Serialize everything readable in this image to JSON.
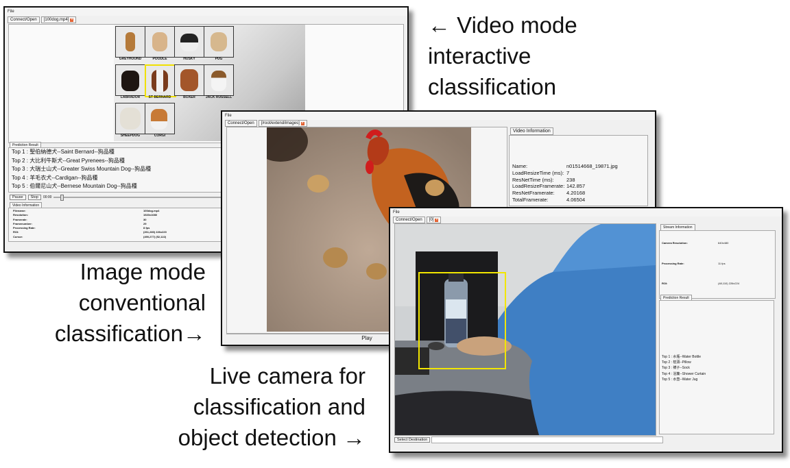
{
  "captions": {
    "video_mode": [
      "← Video mode",
      "interactive",
      "classification"
    ],
    "image_mode": [
      "Image mode",
      "conventional",
      "classification→"
    ],
    "live_camera": [
      "Live camera for",
      "classification and",
      "object detection →"
    ]
  },
  "video_window": {
    "menu": "File",
    "tabs": [
      "Connect/Open",
      "[100dog.mp4]"
    ],
    "breeds": [
      "GREYHOUND",
      "POODLE",
      "HUSKY",
      "PUG",
      "LABRADOR",
      "ST BERNARD",
      "BOXER",
      "JACK RUSSELL",
      "SHEEPDOG",
      "CORGI"
    ],
    "prediction_tab": "Prediction Result",
    "predictions": [
      "Top 1 : 聖伯納德犬--Saint Bernard--狗品種",
      "Top 2 : 大比利牛斯犬--Great Pyrenees--狗品種",
      "Top 3 : 大瑞士山犬--Greater Swiss Mountain Dog--狗品種",
      "Top 4 : 羊毛衣犬--Cardigan--狗品種",
      "Top 5 : 伯爾尼山犬--Bernese Mountain Dog--狗品種"
    ],
    "pause_label": "Pause",
    "stop_label": "Stop",
    "time": "00:00",
    "video_info_tab": "Video Information",
    "video_info": [
      {
        "k": "Filename:",
        "v": "100dog.mp4"
      },
      {
        "k": "Resolution:",
        "v": "1920x1080"
      },
      {
        "k": "Framerate:",
        "v": "30"
      },
      {
        "k": "Framenumber:",
        "v": "29"
      },
      {
        "k": "Processing Rate:",
        "v": "8 fps"
      },
      {
        "k": "ROI:",
        "v": "(261,280) 226x220"
      },
      {
        "k": "Cursor:",
        "v": "(490,277) (52,122)"
      }
    ]
  },
  "image_window": {
    "menu": "File",
    "tabs": [
      "Connect/Open",
      "[/root/extend/images]"
    ],
    "info_tab": "Video Information",
    "info": [
      {
        "k": "Name:",
        "v": "n01514668_19871.jpg"
      },
      {
        "k": "LoadResizeTime (ms):",
        "v": "7"
      },
      {
        "k": "ResNetTime (ms):",
        "v": "238"
      },
      {
        "k": "LoadResizeFramerate:",
        "v": "142.857"
      },
      {
        "k": "ResNetFramerate:",
        "v": "4.20168"
      },
      {
        "k": "TotalFramerate:",
        "v": "4.06504"
      }
    ],
    "play_label": "Play"
  },
  "camera_window": {
    "menu": "File",
    "tabs": [
      "Connect/Open",
      "[0]"
    ],
    "stream_tab": "Stream Information",
    "stream_info": [
      {
        "k": "Camera Resolution:",
        "v": "640x480"
      },
      {
        "k": "Processing Rate:",
        "v": "11 fps"
      },
      {
        "k": "ROI:",
        "v": "(48,110) 226x224"
      }
    ],
    "prediction_tab": "Prediction Result",
    "predictions": [
      "Top 1 : 水瓶--Water Bottle",
      "Top 2 : 枕頭--Pillow",
      "Top 3 : 襪子--Sock",
      "Top 4 : 浴簾--Shower Curtain",
      "Top 5 : 水壺--Water Jug"
    ],
    "select_destination": "Select Destination"
  },
  "colors": {
    "roi_box": "#f2e600",
    "close_tab": "#e26030"
  }
}
